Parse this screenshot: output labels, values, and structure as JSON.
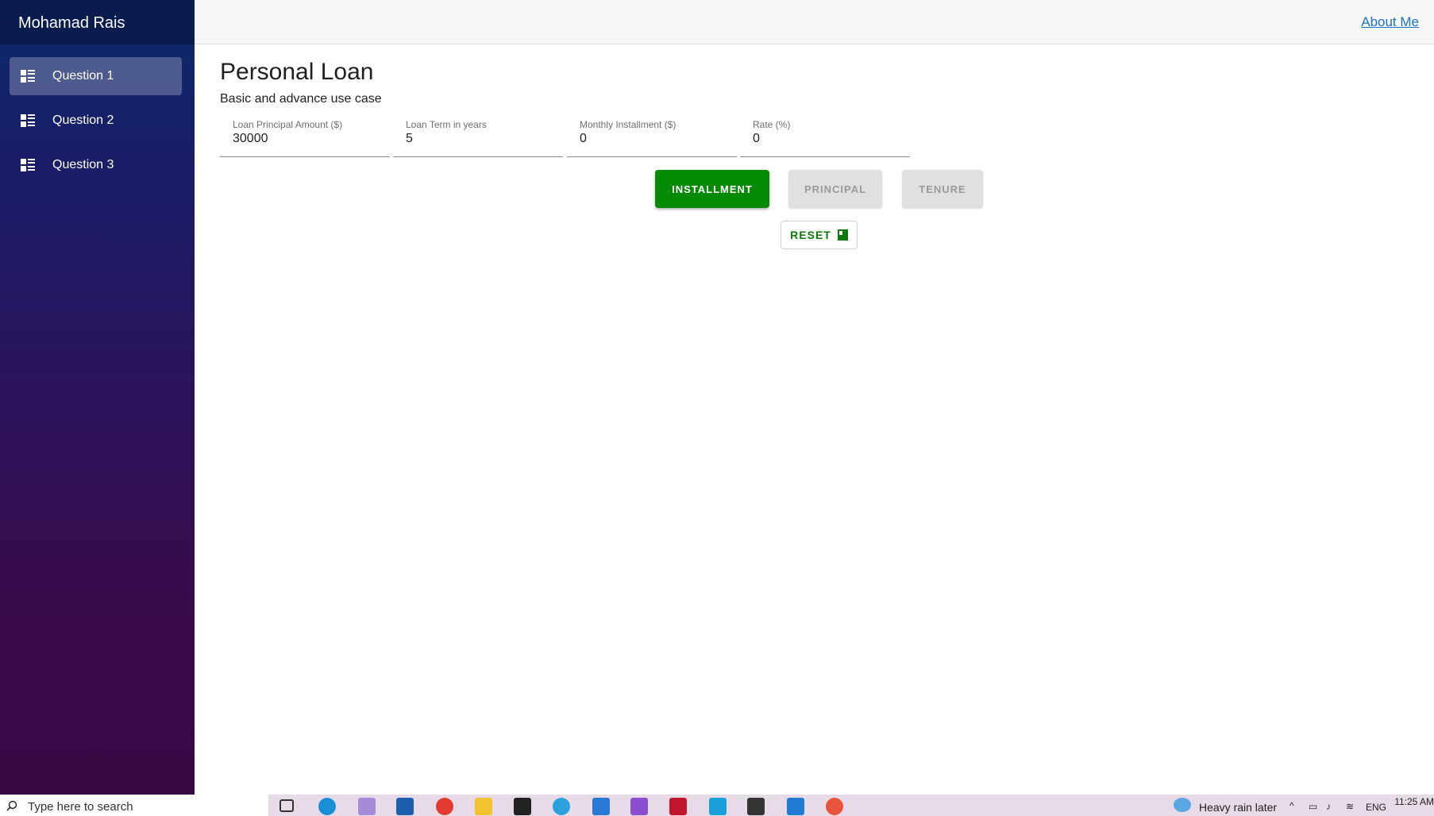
{
  "sidebar": {
    "title": "Mohamad Rais",
    "items": [
      {
        "label": "Question 1",
        "icon": "list-view-icon",
        "active": true
      },
      {
        "label": "Question 2",
        "icon": "list-view-icon",
        "active": false
      },
      {
        "label": "Question 3",
        "icon": "list-view-icon",
        "active": false
      }
    ]
  },
  "topbar": {
    "about_link": "About Me"
  },
  "page": {
    "title": "Personal Loan",
    "subtitle": "Basic and advance use case"
  },
  "form": {
    "principal": {
      "label": "Loan Principal Amount ($)",
      "value": "30000"
    },
    "term": {
      "label": "Loan Term in years",
      "value": "5"
    },
    "installment": {
      "label": "Monthly Installment ($)",
      "value": "0"
    },
    "rate": {
      "label": "Rate (%)",
      "value": "0"
    }
  },
  "buttons": {
    "installment": "INSTALLMENT",
    "principal": "PRINCIPAL",
    "tenure": "TENURE",
    "reset": "RESET"
  },
  "taskbar": {
    "search_placeholder": "Type here to search",
    "weather": "Heavy rain later",
    "language": "ENG",
    "time": "11:25 AM"
  },
  "colors": {
    "primary": "#058a05",
    "link": "#1a73c7",
    "sidebar_top": "#0d2a6b",
    "sidebar_bottom": "#3b0846"
  }
}
